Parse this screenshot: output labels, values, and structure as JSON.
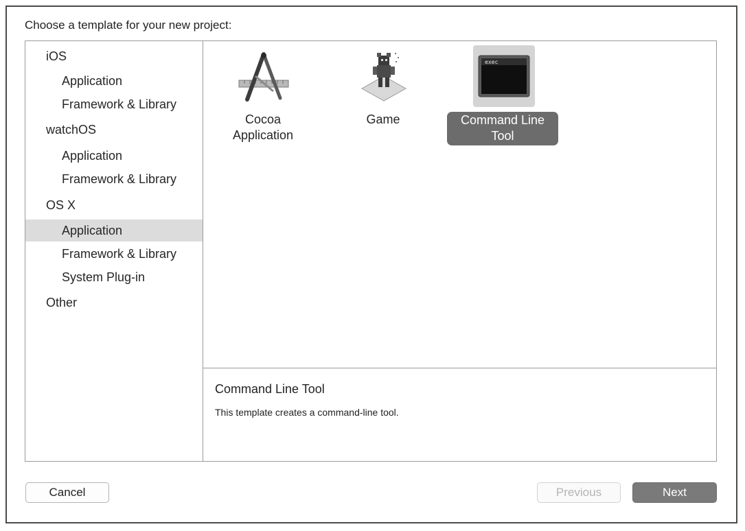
{
  "dialog": {
    "heading": "Choose a template for your new project:"
  },
  "sidebar": {
    "rows": [
      {
        "label": "iOS",
        "kind": "section"
      },
      {
        "label": "Application",
        "kind": "item"
      },
      {
        "label": "Framework & Library",
        "kind": "item"
      },
      {
        "label": "watchOS",
        "kind": "section"
      },
      {
        "label": "Application",
        "kind": "item"
      },
      {
        "label": "Framework & Library",
        "kind": "item"
      },
      {
        "label": "OS X",
        "kind": "section"
      },
      {
        "label": "Application",
        "kind": "item",
        "selected": true
      },
      {
        "label": "Framework & Library",
        "kind": "item"
      },
      {
        "label": "System Plug-in",
        "kind": "item"
      },
      {
        "label": "Other",
        "kind": "section"
      }
    ]
  },
  "templates": [
    {
      "label_line1": "Cocoa",
      "label_line2": "Application",
      "icon": "cocoa-app-icon"
    },
    {
      "label_line1": "Game",
      "label_line2": "",
      "icon": "game-icon"
    },
    {
      "label_line1": "Command Line",
      "label_line2": "Tool",
      "icon": "terminal-exec-icon",
      "selected": true,
      "icon_text": "exec"
    }
  ],
  "description": {
    "title": "Command Line Tool",
    "text": "This template creates a command-line tool."
  },
  "buttons": {
    "cancel": "Cancel",
    "previous": "Previous",
    "next": "Next"
  },
  "colors": {
    "selection_gray": "#6c6c6c",
    "sidebar_selected": "#dcdcdc",
    "next_button": "#7a7a7a"
  }
}
